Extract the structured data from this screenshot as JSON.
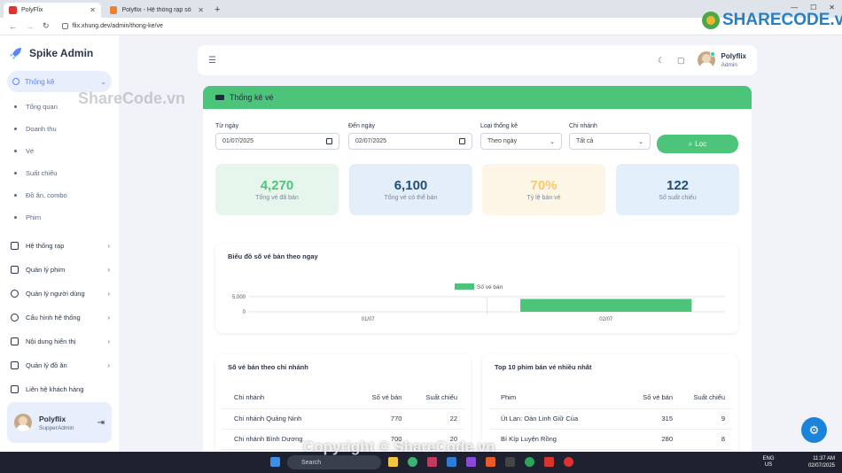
{
  "browser": {
    "tabs": [
      {
        "title": "PolyFlix",
        "active": true
      },
      {
        "title": "Polyflix - Hệ thống rạp số 1 th",
        "active": false
      }
    ],
    "url": "flix.xhung.dev/admin/thong-ke/ve"
  },
  "sidebar": {
    "brand": "Spike Admin",
    "active_section": "Thống kê",
    "sub_items": [
      "Tổng quan",
      "Doanh thu",
      "Vé",
      "Suất chiếu",
      "Đồ ăn, combo",
      "Phim"
    ],
    "items": [
      "Hệ thống rạp",
      "Quản lý phim",
      "Quản lý người dùng",
      "Cấu hình hệ thống",
      "Nội dung hiển thị",
      "Quản lý đồ ăn",
      "Liên hệ khách hàng"
    ],
    "user": {
      "name": "Polyflix",
      "role": "SupperAdmin"
    }
  },
  "header": {
    "user_name": "Polyflix",
    "user_role": "Admin"
  },
  "page": {
    "title": "Thống kê vé",
    "filters": {
      "from_label": "Từ ngày",
      "from_value": "01/07/2025",
      "to_label": "Đến ngày",
      "to_value": "02/07/2025",
      "type_label": "Loại thống kê",
      "type_value": "Theo ngày",
      "branch_label": "Chi nhánh",
      "branch_value": "Tất cả",
      "filter_button": "Lọc"
    },
    "stats": [
      {
        "value": "4,270",
        "label": "Tổng vé đã bán",
        "bg": "#e6f6ec",
        "color": "#4cc47a"
      },
      {
        "value": "6,100",
        "label": "Tổng vé có thể bán",
        "bg": "#e3eef9",
        "color": "#1f4e79"
      },
      {
        "value": "70%",
        "label": "Tỷ lệ bán vé",
        "bg": "#fdf5e6",
        "color": "#f6c96b"
      },
      {
        "value": "122",
        "label": "Số suất chiếu",
        "bg": "#e3f0fb",
        "color": "#1f4e79"
      }
    ],
    "chart_title": "Biểu đồ số vé bán theo ngay",
    "branch_table": {
      "title": "Số vé bán theo chi nhánh",
      "headers": [
        "Chi nhánh",
        "Số vé bán",
        "Suất chiếu"
      ],
      "rows": [
        [
          "Chi nhánh Quảng Ninh",
          "770",
          "22"
        ],
        [
          "Chi nhánh Bình Dương",
          "700",
          "20"
        ]
      ]
    },
    "movie_table": {
      "title": "Top 10 phim bán vé nhiều nhất",
      "headers": [
        "Phim",
        "Số vé bán",
        "Suất chiếu"
      ],
      "rows": [
        [
          "Út Lan: Oán Linh Giữ Của",
          "315",
          "9"
        ],
        [
          "Bí Kíp Luyện Rồng",
          "280",
          "8"
        ]
      ]
    }
  },
  "chart_data": {
    "type": "bar",
    "categories": [
      "01/07",
      "02/07"
    ],
    "series": [
      {
        "name": "Số vé bán",
        "values": [
          0,
          4270
        ]
      }
    ],
    "yticks": [
      "5,000",
      "0"
    ],
    "ylim": [
      0,
      5000
    ],
    "color": "#4cc47a"
  },
  "watermark": {
    "top": "ShareCode.vn",
    "bottom": "Copyright © ShareCode.vn",
    "logo": "SHARECODE.vn"
  },
  "taskbar": {
    "search": "Search",
    "lang": "ENG US",
    "time": "11:37 AM",
    "date": "02/07/2025"
  }
}
